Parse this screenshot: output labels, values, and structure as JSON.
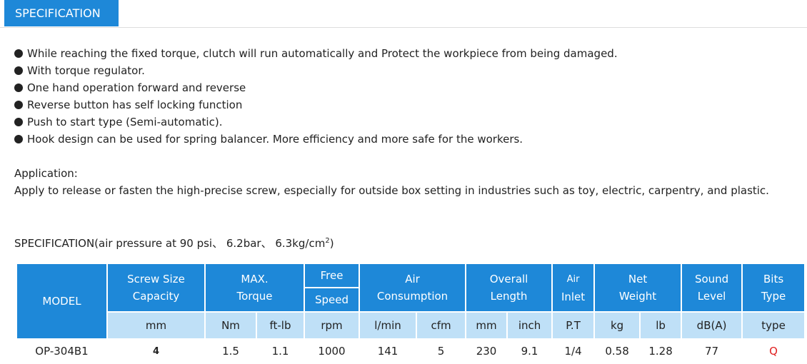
{
  "tab": {
    "label": "SPECIFICATION"
  },
  "bullets": [
    "While reaching the fixed torque, clutch will run automatically and Protect the workpiece from being damaged.",
    "With torque regulator.",
    "One hand operation forward and reverse",
    "Reverse button has self locking function",
    "Push to start type (Semi-automatic).",
    "Hook design can be used for spring balancer. More efficiency and more safe for the workers."
  ],
  "application": {
    "heading": "Application:",
    "text": "Apply to release or fasten the high-precise screw, especially for outside box setting in industries such as toy, electric, carpentry, and plastic."
  },
  "spec": {
    "title_prefix": "SPECIFICATION(air pressure at 90 psi、 6.2bar、 6.3kg/cm",
    "title_sup": "2",
    "title_suffix": ")",
    "headers": {
      "model": "MODEL",
      "screw_size_1": "Screw Size",
      "screw_size_2": "Capacity",
      "max_1": "MAX.",
      "max_2": "Torque",
      "free": "Free",
      "speed": "Speed",
      "air_1": "Air",
      "air_2": "Consumption",
      "overall_1": "Overall",
      "overall_2": "Length",
      "inlet_1": "Air",
      "inlet_2": "Inlet",
      "net_1": "Net",
      "net_2": "Weight",
      "sound_1": "Sound",
      "sound_2": "Level",
      "bits_1": "Bits",
      "bits_2": "Type"
    },
    "units": [
      "mm",
      "Nm",
      "ft-lb",
      "rpm",
      "l/min",
      "cfm",
      "mm",
      "inch",
      "P.T",
      "kg",
      "lb",
      "dB(A)",
      "type"
    ],
    "rows": [
      {
        "model": "OP-304B1",
        "values": [
          "4",
          "1.5",
          "1.1",
          "1000",
          "141",
          "5",
          "230",
          "9.1",
          "1/4",
          "0.58",
          "1.28",
          "77",
          "Q"
        ]
      }
    ],
    "bits_color": "#e02020",
    "header_color": "#1e88d8",
    "units_color": "#bfe0f7"
  }
}
